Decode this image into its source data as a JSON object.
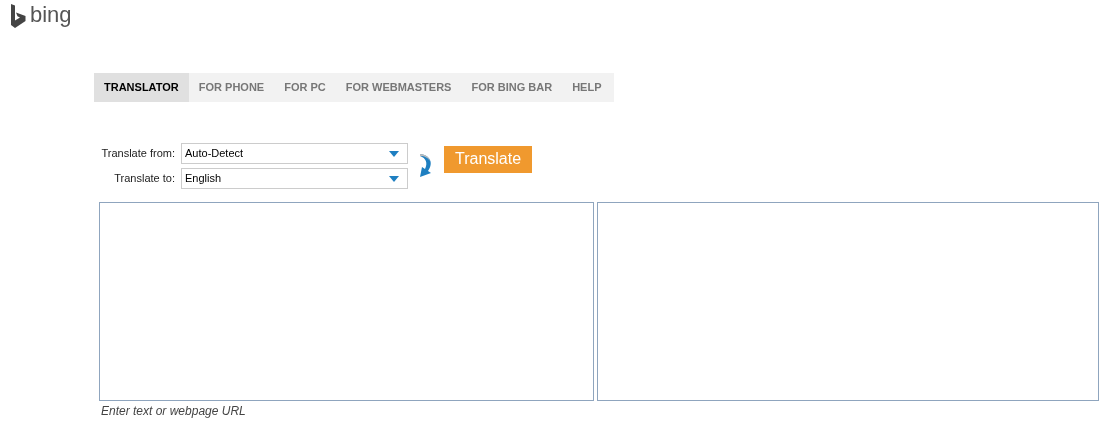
{
  "logo": {
    "text": "bing"
  },
  "tabs": [
    {
      "label": "TRANSLATOR",
      "selected": true
    },
    {
      "label": "FOR PHONE",
      "selected": false
    },
    {
      "label": "FOR PC",
      "selected": false
    },
    {
      "label": "FOR WEBMASTERS",
      "selected": false
    },
    {
      "label": "FOR BING BAR",
      "selected": false
    },
    {
      "label": "HELP",
      "selected": false
    }
  ],
  "from": {
    "label": "Translate from:",
    "value": "Auto-Detect"
  },
  "to": {
    "label": "Translate to:",
    "value": "English"
  },
  "translate_button": "Translate",
  "hint": "Enter text or webpage URL"
}
